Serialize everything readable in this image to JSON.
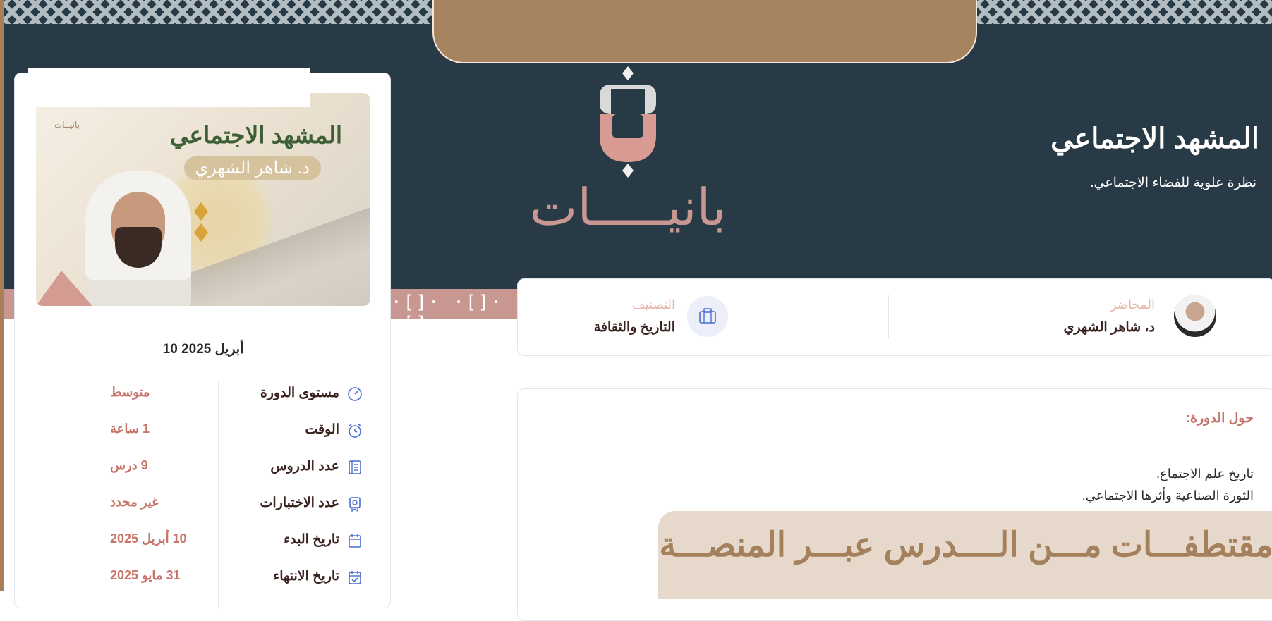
{
  "banner": {
    "title": ""
  },
  "logo": {
    "wordmark": "بانيـــــات"
  },
  "hero": {
    "title": "المشهد الاجتماعي",
    "subtitle": "نظرة علوية للفضاء الاجتماعي."
  },
  "course_card": {
    "thumbnail": {
      "title": "المشهد الاجتماعي",
      "instructor_pill": "د. شاهر الشهري",
      "brand": "بانيــات"
    },
    "date": "10 أبريل 2025",
    "details": [
      {
        "icon": "gauge-icon",
        "label": "مستوى الدورة",
        "value": "متوسط"
      },
      {
        "icon": "alarm-clock-icon",
        "label": "الوقت",
        "value": "1 ساعة"
      },
      {
        "icon": "lessons-list-icon",
        "label": "عدد الدروس",
        "value": "9 درس"
      },
      {
        "icon": "certificate-icon",
        "label": "عدد الاختبارات",
        "value": "غير محدد"
      },
      {
        "icon": "calendar-icon",
        "label": "تاريخ البدء",
        "value": "10 أبريل 2025"
      },
      {
        "icon": "calendar-check-icon",
        "label": "تاريخ الانتهاء",
        "value": "31 مايو 2025"
      }
    ]
  },
  "info": {
    "instructor_caption": "المحاضر",
    "instructor_name": "د، شاهر الشهري",
    "category_caption": "التصنيف",
    "category_value": "التاريخ والثقافة"
  },
  "about": {
    "title": "حول الدورة:",
    "lines": [
      "تاريخ علم الاجتماع.",
      "الثورة الصناعية  وأثرها الاجتماعي."
    ]
  },
  "overlay": {
    "text": "مقتطفـــات مـــن الــــدرس عبـــر المنصـــة"
  },
  "colors": {
    "hero_bg": "#283a45",
    "accent_brown": "#a6845f",
    "accent_pink": "#c99792",
    "value_red": "#c7746a"
  }
}
